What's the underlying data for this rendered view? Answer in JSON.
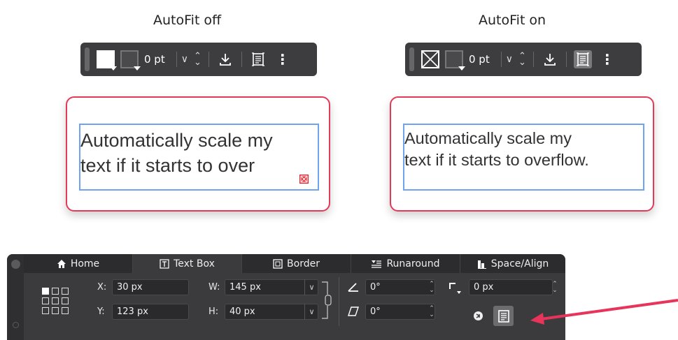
{
  "captions": {
    "off": "AutoFit off",
    "on": "AutoFit on"
  },
  "mini_toolbar_off": {
    "stroke_value": "0 pt",
    "autofit_active": false
  },
  "mini_toolbar_on": {
    "stroke_value": "0 pt",
    "autofit_active": true
  },
  "examples": {
    "off": {
      "line1": "Automatically scale my",
      "line2": "text if it starts to over"
    },
    "on": {
      "line1": "Automatically scale my",
      "line2": "text if it starts to overflow."
    }
  },
  "panel": {
    "tabs": [
      {
        "label": "Home",
        "icon": "home-icon"
      },
      {
        "label": "Text Box",
        "icon": "text-box-icon"
      },
      {
        "label": "Border",
        "icon": "border-icon"
      },
      {
        "label": "Runaround",
        "icon": "runaround-icon"
      },
      {
        "label": "Space/Align",
        "icon": "space-align-icon"
      }
    ],
    "active_tab": "Text Box",
    "x_label": "X:",
    "x_value": "30 px",
    "y_label": "Y:",
    "y_value": "123 px",
    "w_label": "W:",
    "w_value": "145 px",
    "h_label": "H:",
    "h_value": "40 px",
    "rotation_value": "0°",
    "shear_value": "0°",
    "corner_value": "0 px"
  },
  "colors": {
    "highlight": "#e33a5a",
    "frame": "#6fa3ef",
    "panel_bg": "#3b3b3d"
  }
}
